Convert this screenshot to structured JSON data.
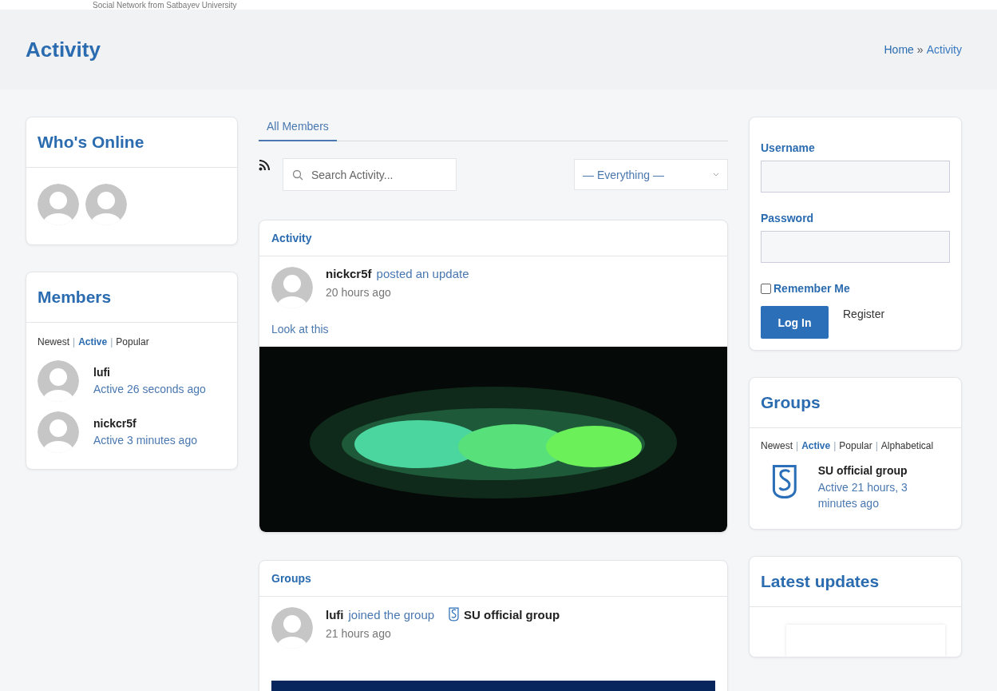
{
  "site": {
    "tagline": "Social Network from Satbayev University"
  },
  "page": {
    "title": "Activity",
    "breadcrumb": [
      {
        "label": "Home",
        "kind": "link"
      },
      {
        "label": "»",
        "kind": "separator"
      },
      {
        "label": "Activity",
        "kind": "current"
      }
    ]
  },
  "whos_online": {
    "title": "Who's Online",
    "users": [
      {
        "kind": "avatar"
      },
      {
        "kind": "avatar"
      }
    ]
  },
  "members": {
    "title": "Members",
    "filters": [
      {
        "label": "Newest",
        "kind": "link",
        "selected": false
      },
      {
        "label": "|",
        "kind": "separator"
      },
      {
        "label": "Active",
        "kind": "link",
        "selected": true
      },
      {
        "label": "|",
        "kind": "separator"
      },
      {
        "label": "Popular",
        "kind": "link",
        "selected": false
      }
    ],
    "items": [
      {
        "name": "lufi",
        "activity": "Active 26 seconds ago"
      },
      {
        "name": "nickcr5f",
        "activity": "Active 3 minutes ago"
      }
    ]
  },
  "activity_tabs": [
    {
      "label": "All Members",
      "selected": true
    }
  ],
  "search": {
    "placeholder": "Search Activity..."
  },
  "filter_select": {
    "value": "— Everything —"
  },
  "feed": [
    {
      "section": "Activity",
      "kind": "update",
      "user": "nickcr5f",
      "action": "posted an update",
      "time": "20 hours ago",
      "text": "Look at this"
    },
    {
      "section": "Groups",
      "kind": "joined",
      "user": "lufi",
      "action": "joined the group",
      "group": "SU official group",
      "time": "21 hours ago"
    }
  ],
  "login": {
    "username_label": "Username",
    "password_label": "Password",
    "remember": {
      "label": "Remember Me",
      "checked": false
    },
    "submit": "Log In",
    "register": "Register"
  },
  "groups": {
    "title": "Groups",
    "filters": [
      {
        "label": "Newest",
        "kind": "link",
        "selected": false
      },
      {
        "label": "|",
        "kind": "separator"
      },
      {
        "label": "Active",
        "kind": "link",
        "selected": true
      },
      {
        "label": "|",
        "kind": "separator"
      },
      {
        "label": "Popular",
        "kind": "link",
        "selected": false
      },
      {
        "label": "|",
        "kind": "separator"
      },
      {
        "label": "Alphabetical",
        "kind": "link",
        "selected": false
      }
    ],
    "items": [
      {
        "name": "SU official group",
        "activity": "Active 21 hours, 3 minutes ago"
      }
    ]
  },
  "latest_updates": {
    "title": "Latest updates"
  }
}
